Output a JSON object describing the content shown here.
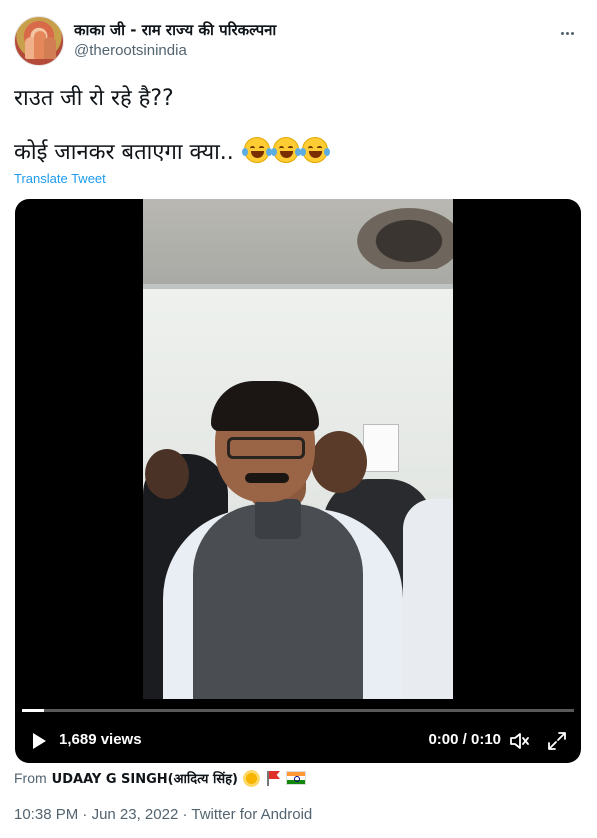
{
  "tweet": {
    "author": {
      "display_name": "काका जी - राम राज्य की परिकल्पना",
      "handle": "@therootsinindia"
    },
    "text_line1": "राउत जी रो रहे है??",
    "text_line2": "कोई जानकर बताएगा क्या..",
    "emoji": "face-with-tears-of-joy-icon",
    "translate_label": "Translate Tweet"
  },
  "video": {
    "views": "1,689 views",
    "time": "0:00 / 0:10",
    "progress": 0.04
  },
  "source": {
    "prefix": "From",
    "name": "UDAAY G SINGH(आदित्य सिंह)"
  },
  "meta": {
    "time": "10:38 PM",
    "separator": "·",
    "date": "Jun 23, 2022",
    "client": "Twitter for Android"
  },
  "colors": {
    "link": "#1d9bf0",
    "secondary_text": "#536471",
    "primary_text": "#0f1419"
  }
}
